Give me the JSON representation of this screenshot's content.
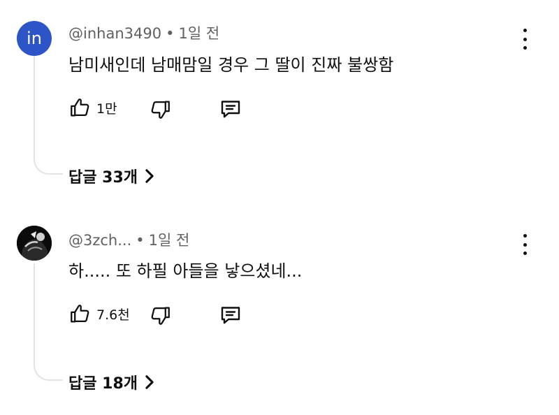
{
  "comments": [
    {
      "avatar_text": "in",
      "author": "@inhan3490",
      "separator": "•",
      "time": "1일 전",
      "text": "남미새인데 남매맘일 경우 그 딸이 진짜 불쌍함",
      "likes": "1만",
      "replies_label": "답글 33개"
    },
    {
      "avatar_text": "",
      "author": "@3zch...",
      "separator": "•",
      "time": "1일 전",
      "text": "하..... 또 하필 아들을 낳으셨네...",
      "likes": "7.6천",
      "replies_label": "답글 18개"
    }
  ],
  "icons": {
    "like": "thumbs-up-icon",
    "dislike": "thumbs-down-icon",
    "reply": "comment-icon",
    "more": "more-vertical-icon",
    "chevron": "chevron-right-icon"
  },
  "colors": {
    "avatar_blue": "#2e55c8",
    "meta_gray": "#606060",
    "thread_line": "#e3e3e3"
  }
}
